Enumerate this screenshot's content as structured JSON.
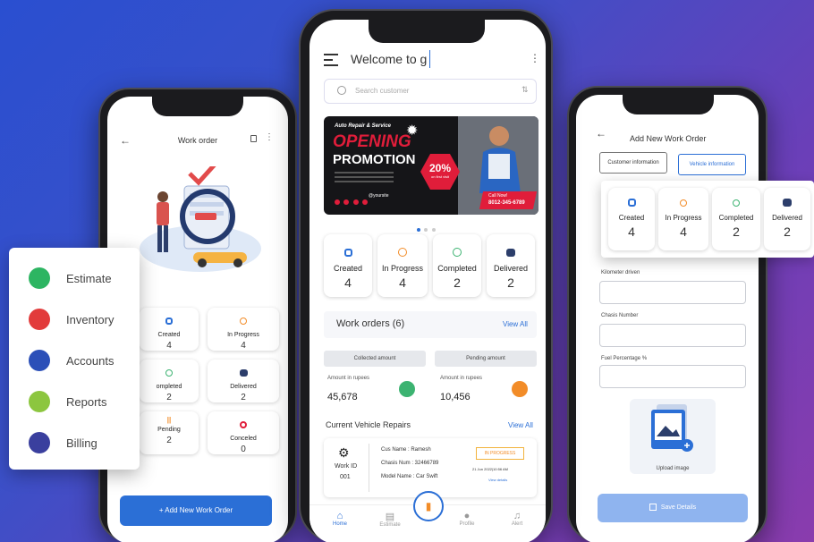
{
  "left": {
    "title": "Work order",
    "tiles": [
      {
        "label": "Created",
        "count": "4"
      },
      {
        "label": "In Progress",
        "count": "4"
      },
      {
        "label": "ompleted",
        "count": "2"
      },
      {
        "label": "Delivered",
        "count": "2"
      },
      {
        "label": "Pending",
        "count": "2"
      },
      {
        "label": "Conceled",
        "count": "0"
      }
    ],
    "add_button": "+ Add New Work Order"
  },
  "menu": {
    "items": [
      {
        "label": "Estimate",
        "color": "#2db562"
      },
      {
        "label": "Inventory",
        "color": "#e23b3b"
      },
      {
        "label": "Accounts",
        "color": "#2b4fb8"
      },
      {
        "label": "Reports",
        "color": "#8cc63f"
      },
      {
        "label": "Billing",
        "color": "#3a3f9e"
      }
    ]
  },
  "center": {
    "welcome": "Welcome to g",
    "search_placeholder": "Search customer",
    "banner": {
      "tag": "Auto Repair & Service",
      "line1": "OPENING",
      "line2": "PROMOTION",
      "discount": "20%",
      "discount_sub": "on first visit",
      "call_label": "Call Now!",
      "phone": "8012-345-6789",
      "site": "@yoursite"
    },
    "stats": [
      {
        "label": "Created",
        "count": "4"
      },
      {
        "label": "In Progress",
        "count": "4"
      },
      {
        "label": "Completed",
        "count": "2"
      },
      {
        "label": "Delivered",
        "count": "2"
      }
    ],
    "work_orders_title": "Work orders (6)",
    "view_all": "View All",
    "collected_title": "Collected amount",
    "pending_title": "Pending amount",
    "amount_label": "Amount in rupees",
    "collected_value": "45,678",
    "pending_value": "10,456",
    "repairs_title": "Current Vehicle Repairs",
    "repairs_view_all": "View All",
    "repair": {
      "work_id_label": "Work ID",
      "work_id": "001",
      "cus_name": "Cus Name : Ramesh",
      "chassis": "Chasis Num : 32466789",
      "model": "Model Name : Car Swift",
      "status": "IN PROGRESS",
      "date": "21 Jun 2022|10:56 AM",
      "view_details": "View details"
    },
    "nav": [
      {
        "label": "Home",
        "icon": "home-icon"
      },
      {
        "label": "Estimate",
        "icon": "estimate-icon"
      },
      {
        "label": "Profile",
        "icon": "profile-icon"
      },
      {
        "label": "Alert",
        "icon": "bell-icon"
      }
    ]
  },
  "right": {
    "title": "Add New Work Order",
    "tab1": "Customer information",
    "tab2": "Vehicle information",
    "stats": [
      {
        "label": "Created",
        "count": "4"
      },
      {
        "label": "In Progress",
        "count": "4"
      },
      {
        "label": "Completed",
        "count": "2"
      },
      {
        "label": "Delivered",
        "count": "2"
      }
    ],
    "field1": "Kilometer driven",
    "field2": "Chasis Number",
    "field3": "Fuel Percentage %",
    "upload_label": "Upload image",
    "save_button": "Save Details"
  },
  "colors": {
    "blue": "#2b6fd6",
    "red": "#e01d3a",
    "orange": "#f28c28",
    "green": "#3cb371"
  }
}
